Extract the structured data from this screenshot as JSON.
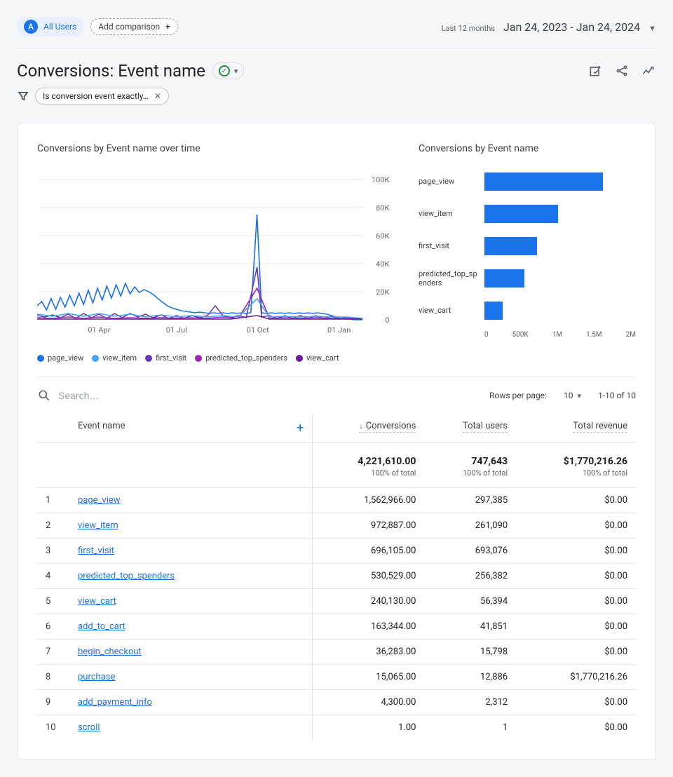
{
  "top": {
    "segment_avatar": "A",
    "segment": "All Users",
    "add_comparison": "Add comparison",
    "period_label": "Last 12 months",
    "date_range": "Jan 24, 2023 - Jan 24, 2024"
  },
  "heading": {
    "title": "Conversions: Event name"
  },
  "filter": {
    "chip": "Is conversion event exactly…"
  },
  "search": {
    "placeholder": "Search…"
  },
  "table_controls": {
    "rows_label": "Rows per page:",
    "rows_value": "10",
    "range": "1-10 of 10"
  },
  "table": {
    "col_event": "Event name",
    "col_conversions": "Conversions",
    "col_users": "Total users",
    "col_revenue": "Total revenue",
    "totals": {
      "conversions": "4,221,610.00",
      "users": "747,643",
      "revenue": "$1,770,216.26",
      "sub": "100% of total"
    },
    "rows": [
      {
        "idx": "1",
        "name": "page_view",
        "conv": "1,562,966.00",
        "users": "297,385",
        "rev": "$0.00"
      },
      {
        "idx": "2",
        "name": "view_item",
        "conv": "972,887.00",
        "users": "261,090",
        "rev": "$0.00"
      },
      {
        "idx": "3",
        "name": "first_visit",
        "conv": "696,105.00",
        "users": "693,076",
        "rev": "$0.00"
      },
      {
        "idx": "4",
        "name": "predicted_top_spenders",
        "conv": "530,529.00",
        "users": "256,382",
        "rev": "$0.00"
      },
      {
        "idx": "5",
        "name": "view_cart",
        "conv": "240,130.00",
        "users": "56,394",
        "rev": "$0.00"
      },
      {
        "idx": "6",
        "name": "add_to_cart",
        "conv": "163,344.00",
        "users": "41,851",
        "rev": "$0.00"
      },
      {
        "idx": "7",
        "name": "begin_checkout",
        "conv": "36,283.00",
        "users": "15,798",
        "rev": "$0.00"
      },
      {
        "idx": "8",
        "name": "purchase",
        "conv": "15,065.00",
        "users": "12,886",
        "rev": "$1,770,216.26"
      },
      {
        "idx": "9",
        "name": "add_payment_info",
        "conv": "4,300.00",
        "users": "2,312",
        "rev": "$0.00"
      },
      {
        "idx": "10",
        "name": "scroll",
        "conv": "1.00",
        "users": "1",
        "rev": "$0.00"
      }
    ]
  },
  "chart_data": [
    {
      "type": "line",
      "title": "Conversions by Event name over time",
      "ylabel": "",
      "ylim": [
        0,
        100000
      ],
      "yticks": [
        "0",
        "20K",
        "40K",
        "60K",
        "80K",
        "100K"
      ],
      "x_ticks": [
        "01 Apr",
        "01 Jul",
        "01 Oct",
        "01 Jan"
      ],
      "legend": [
        "page_view",
        "view_item",
        "first_visit",
        "predicted_top_spenders",
        "view_cart"
      ],
      "colors": {
        "page_view": "#1a73e8",
        "view_item": "#1a73e8",
        "first_visit": "#7b1fa2",
        "predicted_top_spenders": "#7b1fa2",
        "view_cart": "#7b1fa2"
      },
      "series_description": "Five overlapping daily series, most under 20K with a single spike near 75K around Oct; page_view highest roughly 10-20K Jan-Jun then drops to ~5K; others near 0-8K."
    },
    {
      "type": "bar",
      "title": "Conversions by Event name",
      "orientation": "horizontal",
      "xlim": [
        0,
        2000000
      ],
      "xticks": [
        "0",
        "500K",
        "1M",
        "1.5M",
        "2M"
      ],
      "categories": [
        "page_view",
        "view_item",
        "first_visit",
        "predicted_top_spenders",
        "view_cart"
      ],
      "values": [
        1562966,
        972887,
        696105,
        530529,
        240130
      ],
      "color": "#1a73e8"
    }
  ]
}
